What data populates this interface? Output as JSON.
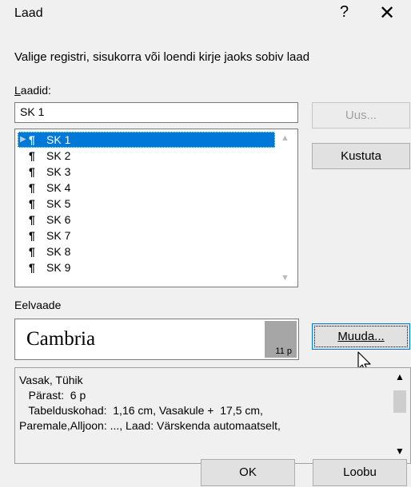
{
  "window": {
    "title": "Laad",
    "help_label": "?",
    "close_label": "✕"
  },
  "instruction": "Valige registri, sisukorra või loendi kirje jaoks sobiv laad",
  "styles_label_prefix": "L",
  "styles_label_rest": "aadid:",
  "style_name_value": "SK 1",
  "styles": [
    {
      "label": "SK 1",
      "selected": true
    },
    {
      "label": "SK 2"
    },
    {
      "label": "SK 3"
    },
    {
      "label": "SK 4"
    },
    {
      "label": "SK 5"
    },
    {
      "label": "SK 6"
    },
    {
      "label": "SK 7"
    },
    {
      "label": "SK 8"
    },
    {
      "label": "SK 9"
    }
  ],
  "paragraph_mark": "¶",
  "buttons": {
    "new": "Uus...",
    "delete": "Kustuta",
    "modify": "Muuda...",
    "ok": "OK",
    "cancel": "Loobu"
  },
  "preview_label": "Eelvaade",
  "preview": {
    "font": "Cambria",
    "size": "11 p"
  },
  "description": [
    "Vasak, Tühik",
    "   Pärast:  6 p",
    "   Tabelduskohad:  1,16 cm, Vasakule +  17,5 cm,",
    "Paremale,Alljoon: ..., Laad: Värskenda automaatselt,"
  ]
}
